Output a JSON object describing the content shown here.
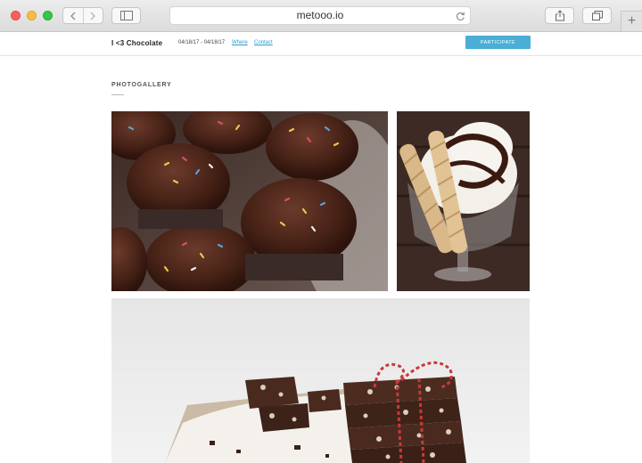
{
  "browser": {
    "url": "metooo.io"
  },
  "site": {
    "brand": "I <3 Chocolate",
    "dates": "04/18/17 - 04/18/17",
    "links": {
      "where": "Where",
      "contact": "Contact"
    },
    "cta": "PARTICIPATE"
  },
  "gallery": {
    "title": "PHOTOGALLERY",
    "photos": [
      {
        "subject": "chocolate cupcakes with sprinkles"
      },
      {
        "subject": "chocolate sundae with wafer rolls"
      },
      {
        "subject": "chocolate bark stack with twine"
      }
    ]
  },
  "colors": {
    "accent": "#4aaed6",
    "link": "#2a9bd2"
  }
}
